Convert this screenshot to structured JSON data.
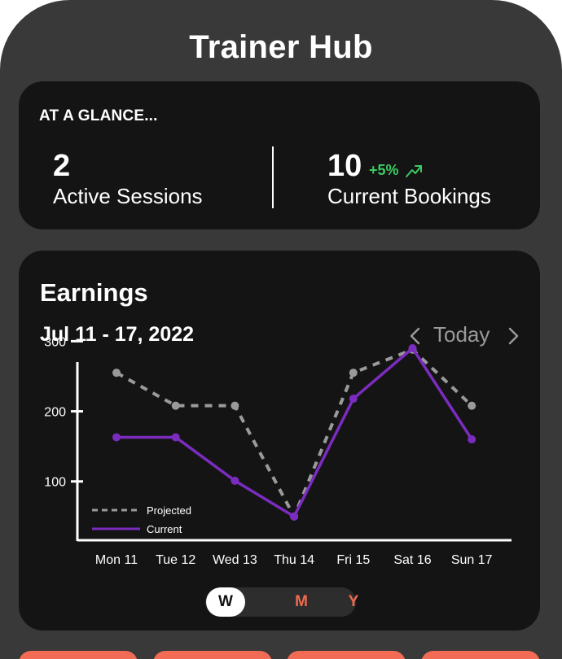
{
  "app": {
    "title": "Trainer Hub"
  },
  "glance": {
    "heading": "AT A GLANCE...",
    "active_sessions": {
      "value": "2",
      "label": "Active Sessions"
    },
    "current_bookings": {
      "value": "10",
      "label": "Current Bookings",
      "trend": "+5%"
    }
  },
  "earnings": {
    "title": "Earnings",
    "date_range": "Jul 11 - 17, 2022",
    "today_label": "Today",
    "toggle": [
      {
        "label": "W",
        "active": true
      },
      {
        "label": "M",
        "active": false
      },
      {
        "label": "Y",
        "active": false
      }
    ]
  },
  "colors": {
    "current": "#7b2cbf",
    "projected": "#9a9a9a",
    "trend_up": "#3ccb63",
    "accent": "#f16b55"
  },
  "chart_data": {
    "type": "line",
    "categories": [
      "Mon 11",
      "Tue 12",
      "Wed 13",
      "Thu 14",
      "Fri 15",
      "Sat 16",
      "Sun 17"
    ],
    "y_ticks": [
      100,
      200,
      300
    ],
    "ylim": [
      0,
      300
    ],
    "legend_position": "bottom-left",
    "grid": false,
    "series": [
      {
        "name": "Projected",
        "style": "dashed",
        "values": [
          255,
          208,
          208,
          50,
          255,
          288,
          208
        ]
      },
      {
        "name": "Current",
        "style": "solid",
        "values": [
          163,
          163,
          101,
          50,
          218,
          290,
          160
        ]
      }
    ]
  },
  "icons": {
    "trend": "trend-up-icon",
    "prev": "chevron-left-icon",
    "next": "chevron-right-icon"
  }
}
